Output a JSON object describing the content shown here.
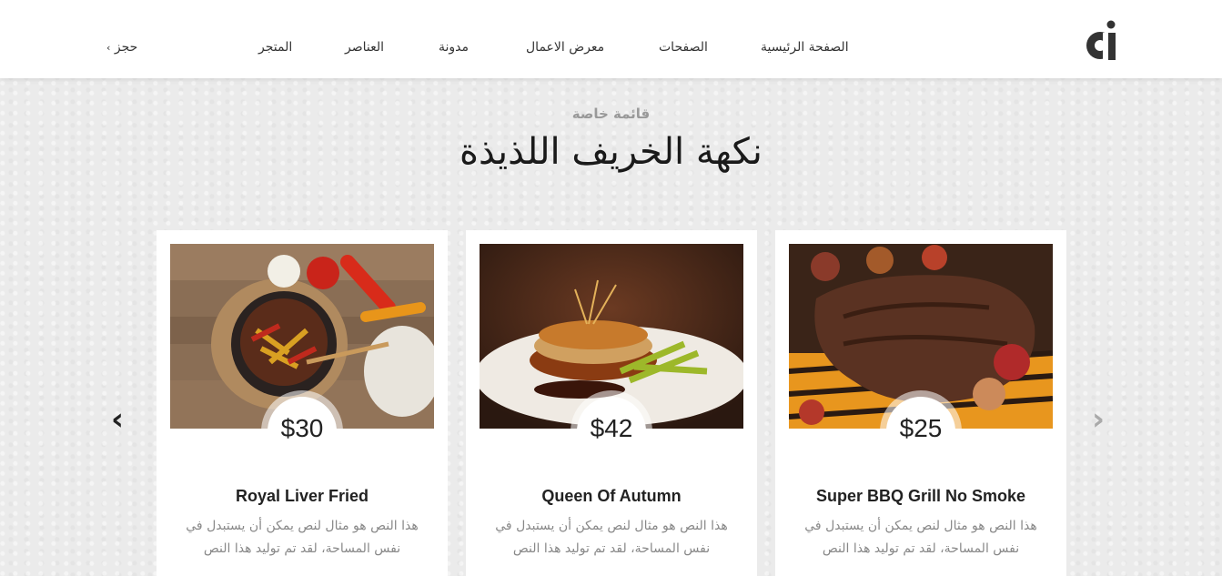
{
  "header": {
    "logo_icon": "ai-logo-icon",
    "nav": [
      {
        "label": "الصفحة الرئيسية"
      },
      {
        "label": "الصفحات"
      },
      {
        "label": "معرض الاعمال"
      },
      {
        "label": "مدونة"
      },
      {
        "label": "العناصر"
      },
      {
        "label": "المتجر"
      }
    ],
    "book_label": "حجز",
    "book_icon": "chevron-right-icon"
  },
  "section": {
    "subtitle": "قائمة خاصة",
    "title": "نكهة الخريف اللذيذة"
  },
  "cards": [
    {
      "name": "Royal Liver Fried",
      "price": "$30",
      "description": "هذا النص هو مثال لنص يمكن أن يستبدل في نفس المساحة، لقد تم توليد هذا النص"
    },
    {
      "name": "Queen Of Autumn",
      "price": "$42",
      "description": "هذا النص هو مثال لنص يمكن أن يستبدل في نفس المساحة، لقد تم توليد هذا النص"
    },
    {
      "name": "Super BBQ Grill No Smoke",
      "price": "$25",
      "description": "هذا النص هو مثال لنص يمكن أن يستبدل في نفس المساحة، لقد تم توليد هذا النص"
    }
  ],
  "carousel": {
    "prev_icon": "chevron-left-icon",
    "next_icon": "chevron-right-icon",
    "prev_color": "#222222",
    "next_color": "#aaaaaa"
  },
  "colors": {
    "background": "#ebebeb",
    "header": "#ffffff",
    "title": "#1a1a1a",
    "muted": "#888888"
  }
}
